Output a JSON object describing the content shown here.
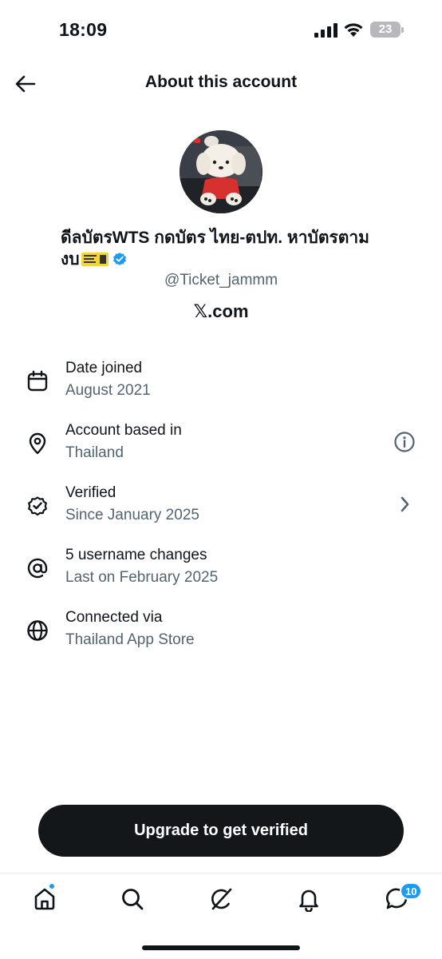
{
  "status_bar": {
    "time": "18:09",
    "battery_level": "23",
    "icons": [
      "signal-icon",
      "wifi-icon",
      "battery-icon"
    ]
  },
  "header": {
    "title": "About this account",
    "back_icon": "arrow-left-icon"
  },
  "profile": {
    "display_name": "ดีลบัตรWTS กดบัตร ไทย-ตปท. หาบัตรตามงบ",
    "username": "@Ticket_jammm",
    "source": "𝕏.com",
    "verified": true,
    "avatar_icon": "avatar-image"
  },
  "info": [
    {
      "icon": "calendar-icon",
      "label": "Date joined",
      "value": "August 2021"
    },
    {
      "icon": "location-pin-icon",
      "label": "Account based in",
      "value": "Thailand",
      "action_icon": "info-icon"
    },
    {
      "icon": "verified-badge-icon",
      "label": "Verified",
      "value": "Since January 2025",
      "action_icon": "chevron-right-icon"
    },
    {
      "icon": "at-sign-icon",
      "label": "5 username changes",
      "value": "Last on February 2025"
    },
    {
      "icon": "globe-icon",
      "label": "Connected via",
      "value": "Thailand App Store"
    }
  ],
  "cta": {
    "label": "Upgrade to get verified"
  },
  "bottom_nav": {
    "items": [
      {
        "name": "home",
        "icon": "home-icon",
        "has_dot": true
      },
      {
        "name": "search",
        "icon": "search-icon"
      },
      {
        "name": "grok",
        "icon": "grok-icon"
      },
      {
        "name": "notifications",
        "icon": "bell-icon"
      },
      {
        "name": "messages",
        "icon": "messages-icon",
        "badge": "10"
      }
    ]
  },
  "colors": {
    "primary_text": "#0f1419",
    "secondary_text": "#536471",
    "accent": "#1d9bf0",
    "button_bg": "#14171a"
  }
}
